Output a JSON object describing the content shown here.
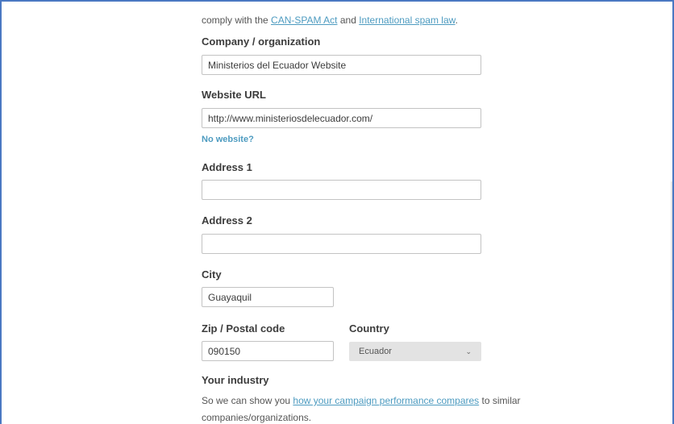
{
  "intro": {
    "prefix": "comply with the ",
    "link1": "CAN-SPAM Act",
    "middle": " and ",
    "link2": "International spam law",
    "suffix": "."
  },
  "company": {
    "label": "Company / organization",
    "value": "Ministerios del Ecuador Website"
  },
  "website": {
    "label": "Website URL",
    "value": "http://www.ministeriosdelecuador.com/",
    "no_website_link": "No website?"
  },
  "address1": {
    "label": "Address 1",
    "value": ""
  },
  "address2": {
    "label": "Address 2",
    "value": ""
  },
  "city": {
    "label": "City",
    "value": "Guayaquil"
  },
  "zip": {
    "label": "Zip / Postal code",
    "value": "090150"
  },
  "country": {
    "label": "Country",
    "selected": "Ecuador",
    "icon": "chevron-down-icon"
  },
  "industry": {
    "label": "Your industry",
    "desc_prefix": "So we can show you ",
    "desc_link": "how your campaign performance compares",
    "desc_suffix": " to similar",
    "desc_line2": "companies/organizations."
  },
  "colors": {
    "link": "#4d9bc0",
    "frame_border": "#4a78c2",
    "select_bg": "#e3e3e3"
  }
}
